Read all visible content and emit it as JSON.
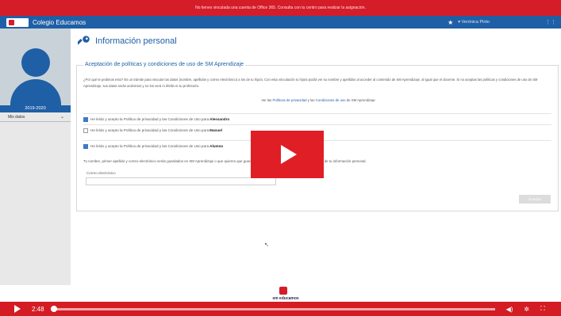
{
  "banner": {
    "text": "No tienes vinculada una cuenta de Office 365. Consulta con tu centro para realizar la asignación."
  },
  "navbar": {
    "title": "Colegio Educamos",
    "user": "▾ Verónica Pinto"
  },
  "sidebar": {
    "year": "2019-2020",
    "menu_item": "Mis datos"
  },
  "page": {
    "title": "Información personal"
  },
  "section": {
    "legend": "Aceptación de políticas y condiciones de uso de SM Aprendizaje",
    "paragraph": "¿Por qué te pedimos esto? Es un trámite para vincular tus datos (nombre, apellidos y correo electrónico) a los de tu hijo/a. Con esta vinculación tu hijo/a podrá ver su nombre y apellidos al acceder al contenido de SM Aprendizaje, al igual que el docente. Si no aceptas las políticas y condiciones de uso de SM Aprendizaje, sus datos serán anónimos y no los verá ni él/ella ni su profesor/a.",
    "links": {
      "prefix": "Ver las",
      "privacy": "Políticas de privacidad",
      "and": "y las",
      "conditions": "Condiciones de uso",
      "suffix": "de SM Aprendizaje"
    },
    "consent_prefix": "He leído y acepto la Política de privacidad y las Condiciones de Uso para",
    "children": [
      {
        "name": "Alessandro",
        "checked": true
      },
      {
        "name": "Manuel",
        "checked": false
      },
      {
        "name": "Alumno",
        "checked": true
      }
    ],
    "storage_note": "Tu nombre, primer apellido y correo electrónico serán guardados en SM Aprendizaje                                                              o que quieres que guardemos. Lo modificaremos también en los datos de tu información personal.",
    "email_label": "Correo electrónico",
    "email_value": "",
    "save_label": "Guardar"
  },
  "footer": {
    "brand": "sm educamos"
  },
  "video": {
    "time": "2:48",
    "progress": 0.0
  },
  "colors": {
    "primary": "#1f5fa6",
    "accent": "#d51c29",
    "video_red": "#d31c23"
  },
  "icons": [
    "key-icon",
    "star-icon",
    "grid-icon",
    "chevron-down-icon",
    "play-icon",
    "volume-icon",
    "settings-icon",
    "fullscreen-icon",
    "cursor-icon"
  ]
}
